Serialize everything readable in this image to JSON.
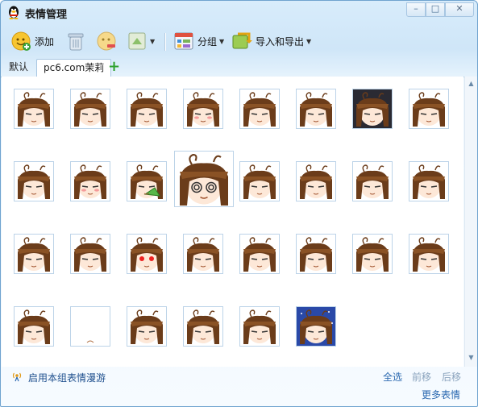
{
  "window": {
    "title": "表情管理",
    "min": "–",
    "max": "□",
    "close": "✕"
  },
  "toolbar": {
    "add_label": "添加",
    "group_label": "分组",
    "import_export_label": "导入和导出"
  },
  "tabs": [
    {
      "label": "默认"
    },
    {
      "label": "pc6.com茉莉"
    }
  ],
  "tab_add": "+",
  "grid": {
    "rows": [
      [
        "default",
        "default",
        "default",
        "blush",
        "default",
        "default",
        "dark",
        "default"
      ],
      [
        "default",
        "blush",
        "fan",
        "big-spiral",
        "default",
        "default",
        "default",
        "default"
      ],
      [
        "default",
        "default",
        "red-eyes",
        "default",
        "default",
        "default",
        "default",
        "default"
      ],
      [
        "default",
        "empty",
        "default",
        "default",
        "default",
        "blue-night"
      ]
    ]
  },
  "footer": {
    "roam_label": "启用本组表情漫游",
    "select_all": "全选",
    "move_forward": "前移",
    "move_back": "后移",
    "more": "更多表情"
  },
  "colors": {
    "hair": "#6b3c1a",
    "skin": "#fde8d8",
    "link": "#2a68b0",
    "disabled": "#8aa3bd"
  }
}
